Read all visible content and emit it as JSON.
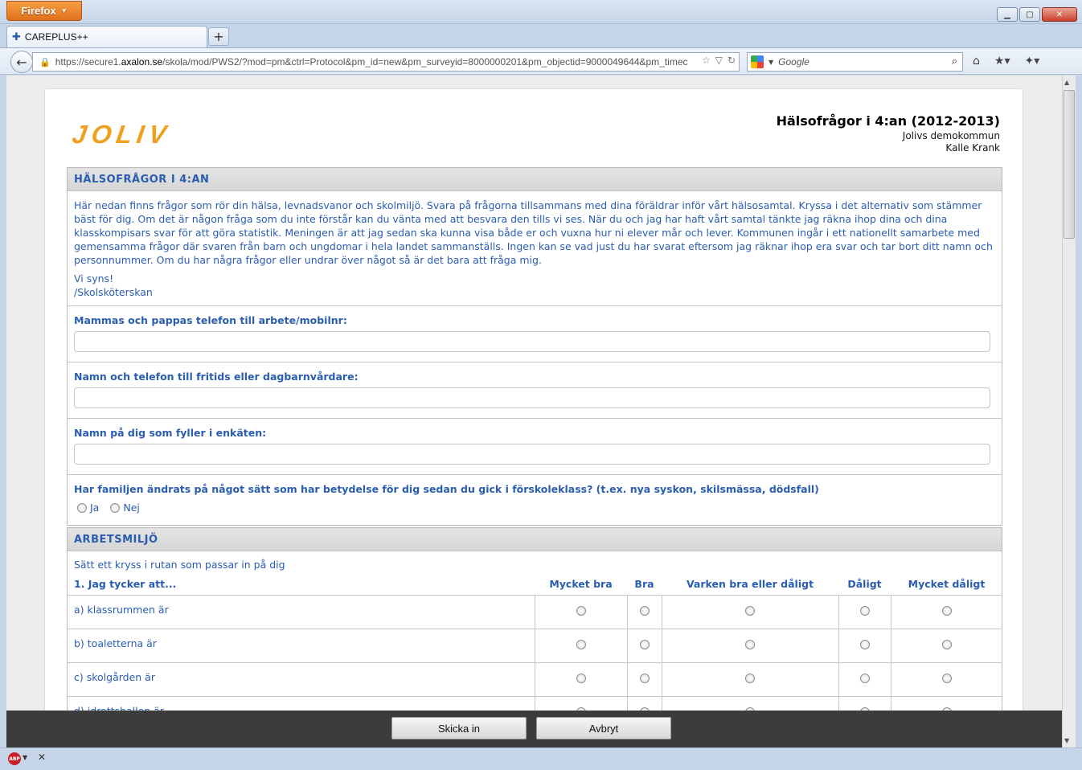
{
  "browser": {
    "menu_label": "Firefox",
    "tab_title": "CAREPLUS++",
    "url_prefix": "https://secure1.",
    "url_domain": "axalon.se",
    "url_rest": "/skola/mod/PWS2/?mod=pm&ctrl=Protocol&pm_id=new&pm_surveyid=8000000201&pm_objectid=9000049644&pm_timec",
    "search_placeholder": "Google"
  },
  "header": {
    "logo": "JOLIV",
    "title": "Hälsofrågor i 4:an (2012-2013)",
    "municipality": "Jolivs demokommun",
    "person": "Kalle Krank"
  },
  "section1": {
    "title": "HÄLSOFRÅGOR I 4:AN",
    "intro": "Här nedan finns frågor som rör din hälsa, levnadsvanor och skolmiljö. Svara på frågorna tillsammans med dina föräldrar inför vårt hälsosamtal. Kryssa i det alternativ som stämmer bäst för dig. Om det är någon fråga som du inte förstår kan du vänta med att besvara den tills vi ses. När du och jag har haft vårt samtal tänkte jag räkna ihop dina och dina klasskompisars svar för att göra statistik. Meningen är att jag sedan ska kunna visa både er och vuxna hur ni elever mår och lever. Kommunen ingår i ett nationellt samarbete med gemensamma frågor där svaren från barn och ungdomar i hela landet sammanställs. Ingen kan se vad just du har svarat eftersom jag räknar ihop era svar och tar bort ditt namn och personnummer. Om du har några frågor eller undrar över något så är det bara att fråga mig.",
    "greeting1": "Vi syns!",
    "greeting2": "/Skolsköterskan",
    "q_phone": "Mammas och pappas telefon till arbete/mobilnr:",
    "q_leisure": "Namn och telefon till fritids eller dagbarnvårdare:",
    "q_name": "Namn på dig som fyller i enkäten:",
    "q_family": "Har familjen ändrats på något sätt som har betydelse för dig sedan du gick i förskoleklass? (t.ex. nya syskon, skilsmässa, dödsfall)",
    "opt_yes": "Ja",
    "opt_no": "Nej"
  },
  "section2": {
    "title": "ARBETSMILJÖ",
    "instruction": "Sätt ett kryss i rutan som passar in på dig",
    "question": "1. Jag tycker att...",
    "columns": [
      "Mycket bra",
      "Bra",
      "Varken bra eller dåligt",
      "Dåligt",
      "Mycket dåligt"
    ],
    "rows": [
      "a) klassrummen är",
      "b) toaletterna är",
      "c) skolgården är",
      "d) idrottshallen är"
    ]
  },
  "actions": {
    "submit": "Skicka in",
    "cancel": "Avbryt"
  }
}
